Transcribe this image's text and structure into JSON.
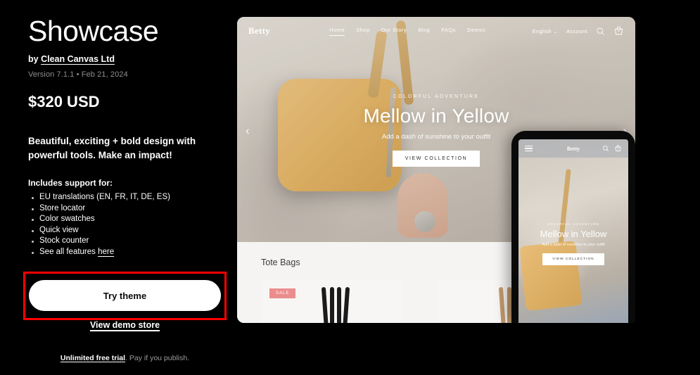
{
  "theme": {
    "title": "Showcase",
    "by_prefix": "by ",
    "vendor": "Clean Canvas Ltd",
    "version_line": "Version 7.1.1 • Feb 21, 2024",
    "price": "$320 USD",
    "tagline": "Beautiful, exciting + bold design with powerful tools. Make an impact!",
    "support_heading": "Includes support for:",
    "features": [
      {
        "text": "EU translations (EN, FR, IT, DE, ES)",
        "link": null
      },
      {
        "text": "Store locator",
        "link": null
      },
      {
        "text": "Color swatches",
        "link": null
      },
      {
        "text": "Quick view",
        "link": null
      },
      {
        "text": "Stock counter",
        "link": null
      },
      {
        "text": "See all features ",
        "link": "here"
      }
    ]
  },
  "actions": {
    "try_theme": "Try theme",
    "view_demo": "View demo store",
    "trial_link": "Unlimited free trial",
    "trial_rest": ". Pay if you publish.",
    "highlight_color": "#ff0000"
  },
  "preview": {
    "store": {
      "logo": "Betty",
      "nav": [
        {
          "label": "Home",
          "active": true
        },
        {
          "label": "Shop",
          "active": false
        },
        {
          "label": "Our Story",
          "active": false
        },
        {
          "label": "Blog",
          "active": false
        },
        {
          "label": "FAQs",
          "active": false
        },
        {
          "label": "Demos",
          "active": false
        }
      ],
      "language": "English",
      "account": "Account",
      "cart_count": "0"
    },
    "hero": {
      "eyebrow": "COLORFUL ADVENTURE",
      "heading": "Mellow in Yellow",
      "subheading": "Add a dash of sunshine to your outfit",
      "cta": "VIEW COLLECTION",
      "prev_arrow": "‹",
      "next_arrow": "›"
    },
    "collection": {
      "title": "Tote Bags",
      "products": [
        {
          "badge": "SALE",
          "color": "black"
        },
        {
          "badge": "",
          "color": "tan"
        }
      ]
    },
    "mobile": {
      "logo": "Betty",
      "cart_count": "0",
      "eyebrow": "COLORFUL ADVENTURE",
      "heading": "Mellow in Yellow",
      "subheading": "Add a dash of sunshine to your outfit",
      "cta": "VIEW COLLECTION"
    }
  }
}
